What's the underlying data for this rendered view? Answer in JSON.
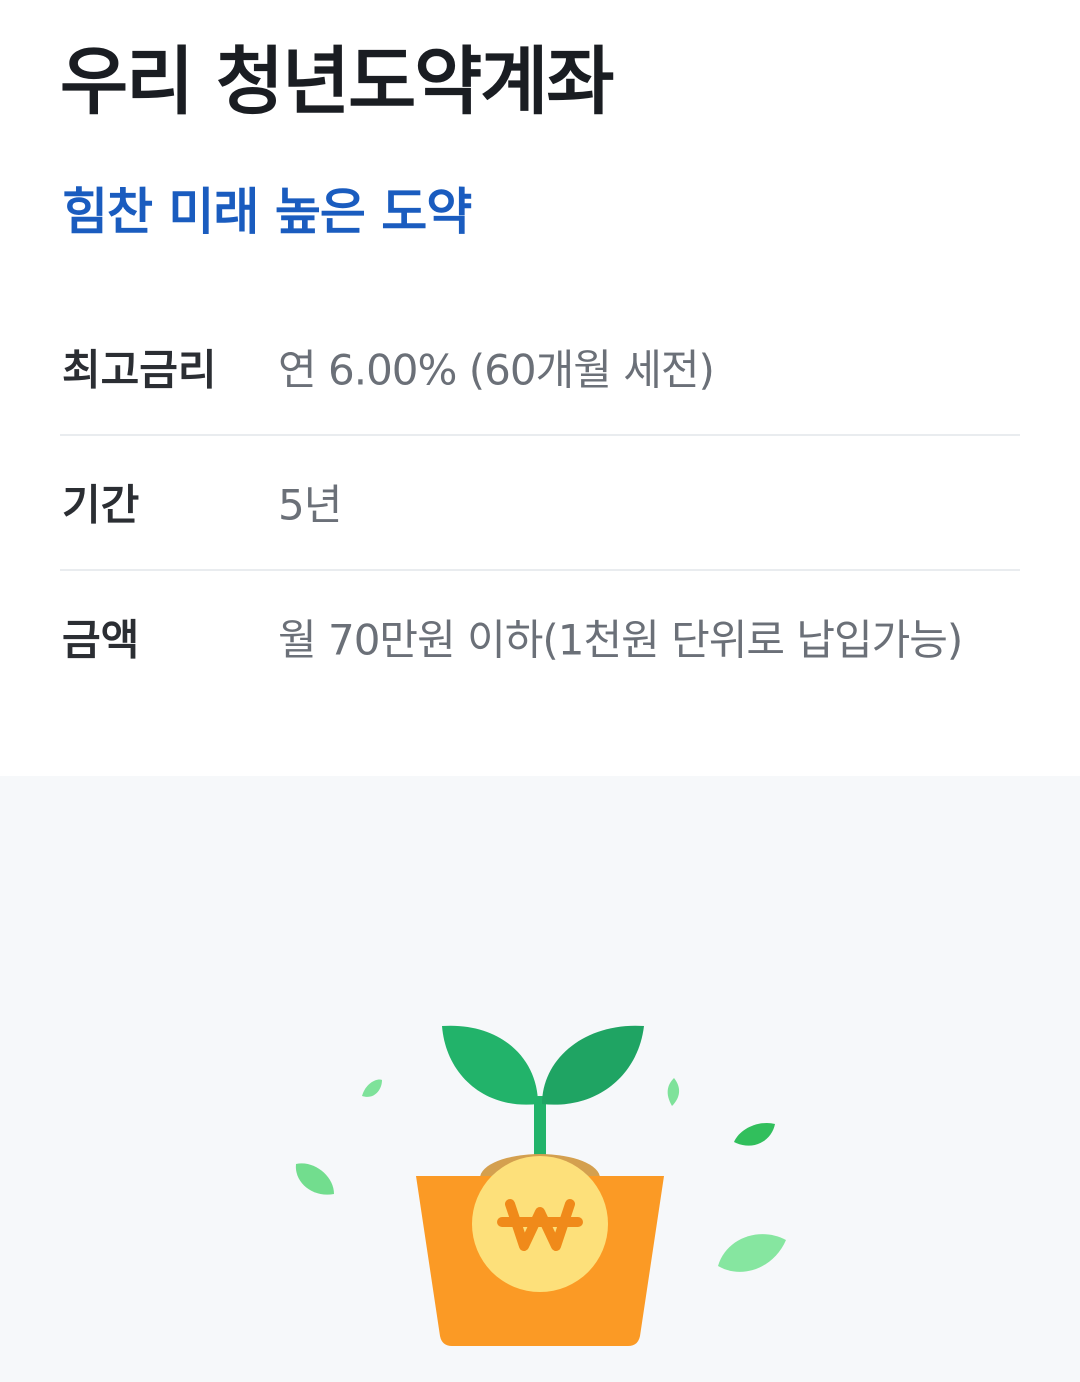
{
  "header": {
    "title": "우리 청년도약계좌",
    "subtitle": "힘찬 미래 높은 도약"
  },
  "info_rows": [
    {
      "label": "최고금리",
      "value": "연 6.00% (60개월 세전)"
    },
    {
      "label": "기간",
      "value": "5년"
    },
    {
      "label": "금액",
      "value": "월 70만원 이하(1천원 단위로 납입가능)"
    }
  ],
  "illustration": {
    "icon": "sprout-pot-icon",
    "coin_symbol": "₩",
    "colors": {
      "leaf": "#22b36a",
      "leaf_dark": "#1fa463",
      "pot": "#fb9a25",
      "coin": "#fde07a",
      "coin_text": "#f08a1a",
      "background": "#f6f8fa"
    }
  }
}
